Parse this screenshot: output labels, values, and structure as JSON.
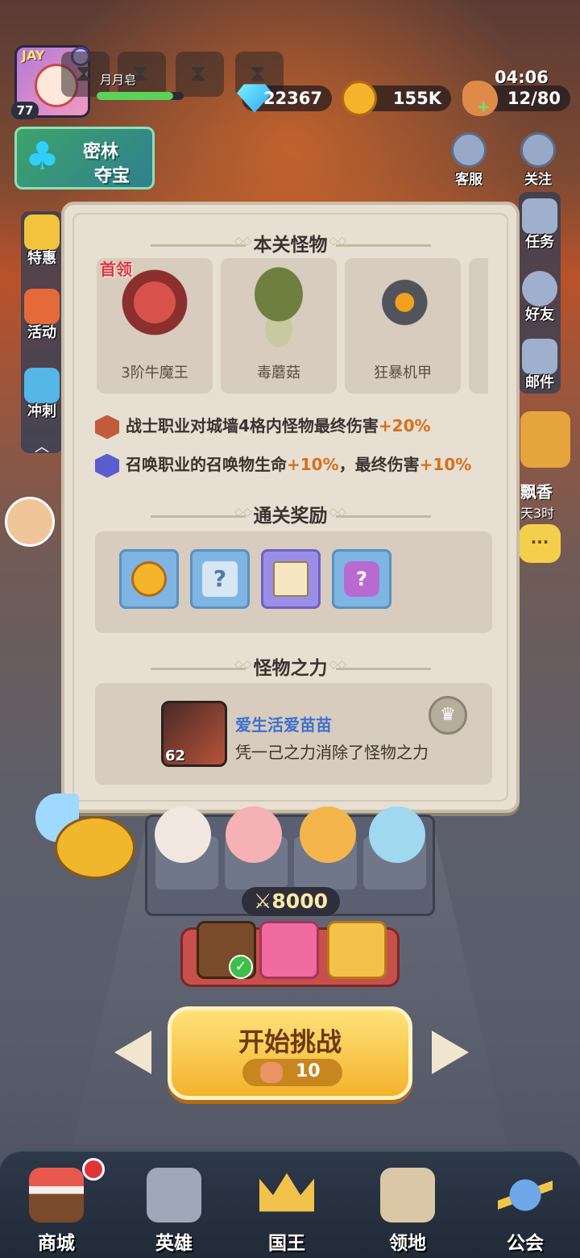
{
  "hud": {
    "player_level": "77",
    "player_badge": "JAY",
    "nickname": "月月皂",
    "gems": "22367",
    "coins": "155K",
    "stamina": "12/80",
    "timer": "04:06",
    "event_title_line1": "密林",
    "event_title_line2": "夺宝"
  },
  "top_right": {
    "service_label": "客服",
    "follow_label": "关注"
  },
  "side_left": {
    "items": [
      {
        "label": "特惠"
      },
      {
        "label": "活动"
      },
      {
        "label": "冲刺"
      }
    ]
  },
  "side_right": {
    "items": [
      {
        "label": "任务"
      },
      {
        "label": "好友"
      },
      {
        "label": "邮件"
      }
    ],
    "event_label": "飘香",
    "event_time": "天3时"
  },
  "panel": {
    "monsters_title": "本关怪物",
    "boss_tag": "首领",
    "monsters": [
      {
        "name": "3阶牛魔王"
      },
      {
        "name": "毒蘑菇"
      },
      {
        "name": "狂暴机甲"
      }
    ],
    "buffs": [
      {
        "text": "战士职业对城墙4格内怪物最终伤害",
        "value": "+20%"
      },
      {
        "text": "召唤职业的召唤物生命",
        "value1": "+10%",
        "mid": "，最终伤害",
        "value2": "+10%"
      }
    ],
    "rewards_title": "通关奖励",
    "rewards": [
      {
        "icon": "coin-icon",
        "glyph": ""
      },
      {
        "icon": "mystery-scroll-icon",
        "glyph": "?"
      },
      {
        "icon": "skill-book-icon",
        "glyph": ""
      },
      {
        "icon": "mystery-gift-icon",
        "glyph": "?"
      }
    ],
    "power_title": "怪物之力",
    "power_player": {
      "level": "62",
      "name": "爱生活爱苗苗",
      "desc": "凭一己之力消除了怪物之力"
    }
  },
  "battle": {
    "team_power": "8000",
    "start_label": "开始挑战",
    "start_cost": "10"
  },
  "nav": {
    "items": [
      {
        "label": "商城"
      },
      {
        "label": "英雄"
      },
      {
        "label": "国王"
      },
      {
        "label": "领地"
      },
      {
        "label": "公会"
      }
    ]
  },
  "colors": {
    "accent_orange": "#d4711e",
    "player_blue": "#3f6fd1",
    "boss_red": "#e0343a"
  }
}
